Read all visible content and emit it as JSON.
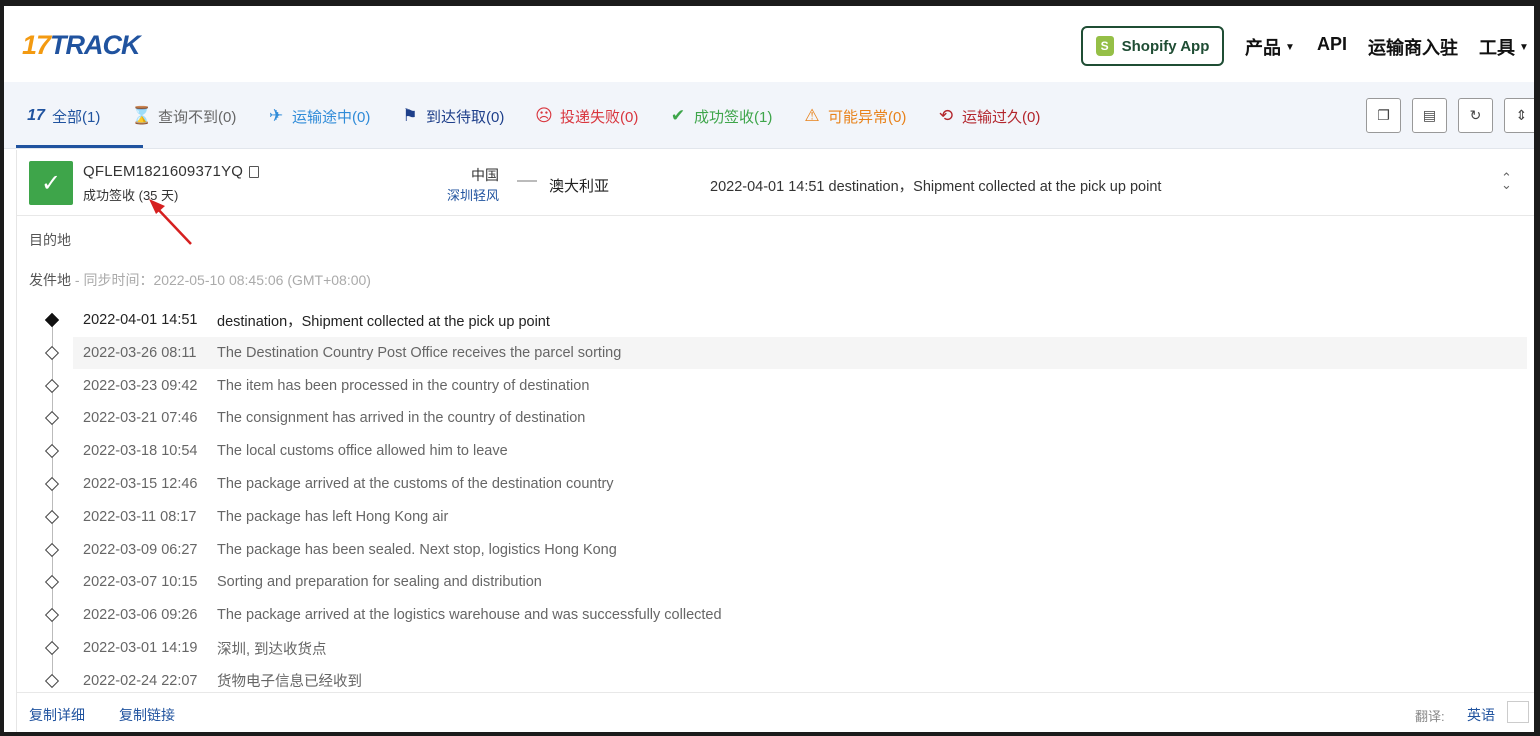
{
  "header": {
    "logo_num": "17",
    "logo_text": "TRACK",
    "shopify_label": "Shopify App",
    "nav": [
      {
        "label": "产品"
      },
      {
        "label": "API"
      },
      {
        "label": "运输商入驻"
      },
      {
        "label": "工具"
      }
    ]
  },
  "tabs": [
    {
      "label": "全部(1)",
      "icon": "17-logo-icon",
      "color": "#20539f"
    },
    {
      "label": "查询不到(0)",
      "icon": "hourglass-icon",
      "color": "#666666"
    },
    {
      "label": "运输途中(0)",
      "icon": "airplane-icon",
      "color": "#2f8bd8"
    },
    {
      "label": "到达待取(0)",
      "icon": "flag-icon",
      "color": "#1e3f8a"
    },
    {
      "label": "投递失败(0)",
      "icon": "sad-face-icon",
      "color": "#d9363e"
    },
    {
      "label": "成功签收(1)",
      "icon": "check-icon",
      "color": "#3ea54a"
    },
    {
      "label": "可能异常(0)",
      "icon": "warning-icon",
      "color": "#e8821a"
    },
    {
      "label": "运输过久(0)",
      "icon": "history-clock-icon",
      "color": "#b3262d"
    }
  ],
  "shipment": {
    "tracking_number": "QFLEM1821609371YQ",
    "status_text": "成功签收 (35 天)",
    "origin_country": "中国",
    "origin_carrier": "深圳轻风",
    "destination_country": "澳大利亚",
    "latest_event": "2022-04-01 14:51  destination，Shipment collected at the pick up point"
  },
  "sections": {
    "destination_label": "目的地",
    "origin_label": "发件地",
    "sync_text": " - 同步时间：2022-05-10 08:45:06 (GMT+08:00)"
  },
  "events": [
    {
      "time": "2022-04-01 14:51",
      "desc": "destination，Shipment collected at the pick up point"
    },
    {
      "time": "2022-03-26 08:11",
      "desc": "The Destination Country Post Office receives the parcel sorting"
    },
    {
      "time": "2022-03-23 09:42",
      "desc": "The item has been processed in the country of destination"
    },
    {
      "time": "2022-03-21 07:46",
      "desc": "The consignment has arrived in the country of destination"
    },
    {
      "time": "2022-03-18 10:54",
      "desc": "The local customs office allowed him to leave"
    },
    {
      "time": "2022-03-15 12:46",
      "desc": "The package arrived at the customs of the destination country"
    },
    {
      "time": "2022-03-11 08:17",
      "desc": "The package has left Hong Kong air"
    },
    {
      "time": "2022-03-09 06:27",
      "desc": "The package has been sealed. Next stop, logistics Hong Kong"
    },
    {
      "time": "2022-03-07 10:15",
      "desc": "Sorting and preparation for sealing and distribution"
    },
    {
      "time": "2022-03-06 09:26",
      "desc": "The package arrived at the logistics warehouse and was successfully collected"
    },
    {
      "time": "2022-03-01 14:19",
      "desc": "深圳, 到达收货点"
    },
    {
      "time": "2022-02-24 22:07",
      "desc": "货物电子信息已经收到"
    }
  ],
  "footer": {
    "copy_details": "复制详细",
    "copy_link": "复制链接",
    "translate_label": "翻译:",
    "translate_value": "英语"
  }
}
